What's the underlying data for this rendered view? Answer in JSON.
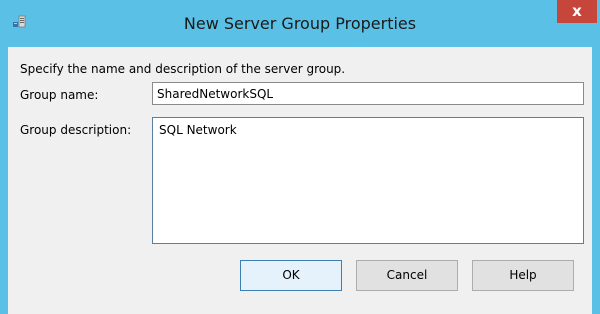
{
  "window": {
    "title": "New Server Group Properties",
    "close_label": "x",
    "icon": "server-group-icon"
  },
  "form": {
    "instruction": "Specify the name and description of the server group.",
    "group_name_label": "Group name:",
    "group_name_value": "SharedNetworkSQL",
    "group_description_label": "Group description:",
    "group_description_value": "SQL Network"
  },
  "buttons": {
    "ok": "OK",
    "cancel": "Cancel",
    "help": "Help"
  },
  "colors": {
    "titlebar": "#5bc0e5",
    "close": "#c7463c",
    "client": "#f0f0f0"
  }
}
